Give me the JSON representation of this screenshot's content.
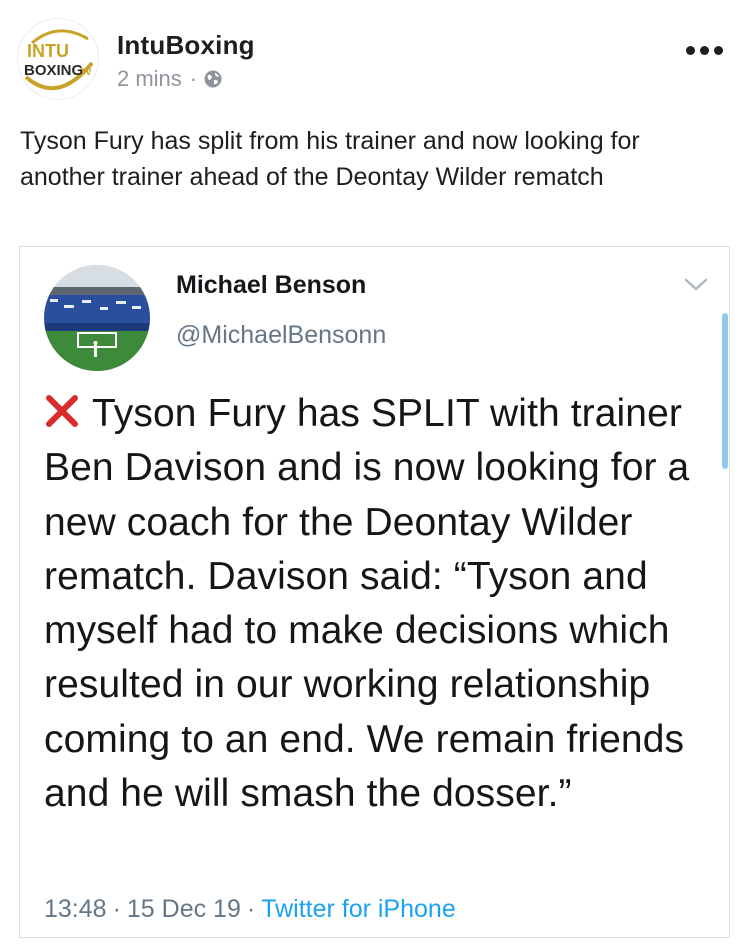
{
  "post": {
    "page_name": "IntuBoxing",
    "time": "2 mins",
    "separator": "·",
    "logo_text_top": "INTU",
    "logo_text_bottom": "BOXING",
    "logo_text_tv": "TV",
    "text": "Tyson Fury has split from his trainer and now looking for another trainer ahead of the Deontay Wilder rematch"
  },
  "tweet": {
    "name": "Michael Benson",
    "handle": "@MichaelBensonn",
    "body": "Tyson Fury has SPLIT with trainer Ben Davison and is now looking for a new coach for the Deontay Wilder rematch. Davison said: “Tyson and myself had to make decisions which resulted in our working relationship coming to an end. We remain friends and he will smash the dosser.”",
    "time": "13:48",
    "date": "15 Dec 19",
    "separator": "·",
    "source": "Twitter for iPhone"
  },
  "colors": {
    "link_blue": "#1da1f2",
    "meta_gray": "#90949c",
    "x_red": "#d92c2c",
    "logo_gold": "#c9a227"
  },
  "icons": {
    "globe": "globe-icon",
    "more": "more-options-icon",
    "chevron": "chevron-down-icon",
    "cross": "cross-mark-icon"
  }
}
